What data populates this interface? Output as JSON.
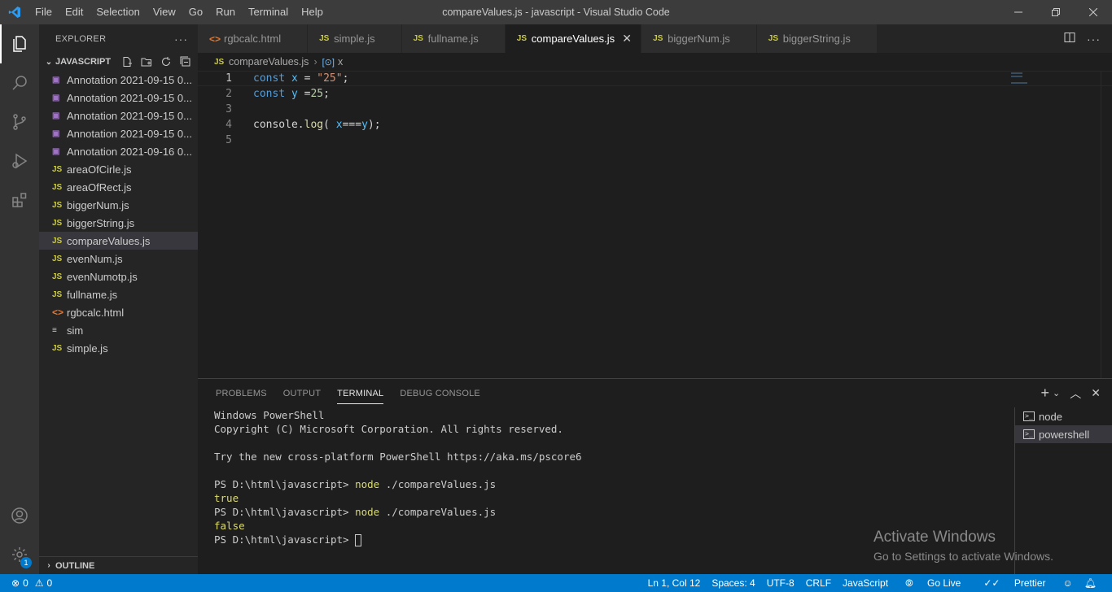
{
  "window": {
    "title": "compareValues.js - javascript - Visual Studio Code",
    "menu": [
      "File",
      "Edit",
      "Selection",
      "View",
      "Go",
      "Run",
      "Terminal",
      "Help"
    ]
  },
  "sidebar": {
    "header": "EXPLORER",
    "folder": "JAVASCRIPT",
    "files": [
      {
        "name": "Annotation 2021-09-15 0...",
        "type": "img"
      },
      {
        "name": "Annotation 2021-09-15 0...",
        "type": "img"
      },
      {
        "name": "Annotation 2021-09-15 0...",
        "type": "img"
      },
      {
        "name": "Annotation 2021-09-15 0...",
        "type": "img"
      },
      {
        "name": "Annotation 2021-09-16 0...",
        "type": "img"
      },
      {
        "name": "areaOfCirle.js",
        "type": "js"
      },
      {
        "name": "areaOfRect.js",
        "type": "js"
      },
      {
        "name": "biggerNum.js",
        "type": "js"
      },
      {
        "name": "biggerString.js",
        "type": "js"
      },
      {
        "name": "compareValues.js",
        "type": "js",
        "selected": true
      },
      {
        "name": "evenNum.js",
        "type": "js"
      },
      {
        "name": "evenNumotp.js",
        "type": "js"
      },
      {
        "name": "fullname.js",
        "type": "js"
      },
      {
        "name": "rgbcalc.html",
        "type": "html"
      },
      {
        "name": "sim",
        "type": "txt"
      },
      {
        "name": "simple.js",
        "type": "js"
      }
    ],
    "outline": "OUTLINE"
  },
  "tabs": [
    {
      "label": "rgbcalc.html",
      "type": "html"
    },
    {
      "label": "simple.js",
      "type": "js"
    },
    {
      "label": "fullname.js",
      "type": "js"
    },
    {
      "label": "compareValues.js",
      "type": "js",
      "active": true
    },
    {
      "label": "biggerNum.js",
      "type": "js"
    },
    {
      "label": "biggerString.js",
      "type": "js"
    }
  ],
  "breadcrumb": {
    "file": "compareValues.js",
    "symbol": "x"
  },
  "editor": {
    "line_numbers": [
      "1",
      "2",
      "3",
      "4",
      "5"
    ],
    "lines": [
      [
        {
          "t": "const ",
          "c": "kw"
        },
        {
          "t": "x",
          "c": "var"
        },
        {
          "t": " = ",
          "c": "plain"
        },
        {
          "t": "\"25\"",
          "c": "str"
        },
        {
          "t": ";",
          "c": "plain"
        }
      ],
      [
        {
          "t": "const ",
          "c": "kw"
        },
        {
          "t": "y",
          "c": "var"
        },
        {
          "t": " =",
          "c": "plain"
        },
        {
          "t": "25",
          "c": "num"
        },
        {
          "t": ";",
          "c": "plain"
        }
      ],
      [],
      [
        {
          "t": "console",
          "c": "plain"
        },
        {
          "t": ".",
          "c": "plain"
        },
        {
          "t": "log",
          "c": "fn"
        },
        {
          "t": "( ",
          "c": "plain"
        },
        {
          "t": "x",
          "c": "var"
        },
        {
          "t": "===",
          "c": "plain"
        },
        {
          "t": "y",
          "c": "var"
        },
        {
          "t": ");",
          "c": "plain"
        }
      ],
      []
    ]
  },
  "panel": {
    "tabs": [
      "PROBLEMS",
      "OUTPUT",
      "TERMINAL",
      "DEBUG CONSOLE"
    ],
    "active_tab": "TERMINAL",
    "terminal_lines": [
      {
        "text": "Windows PowerShell"
      },
      {
        "text": "Copyright (C) Microsoft Corporation. All rights reserved."
      },
      {
        "text": ""
      },
      {
        "text": "Try the new cross-platform PowerShell https://aka.ms/pscore6"
      },
      {
        "text": ""
      },
      {
        "prompt": "PS D:\\html\\javascript> ",
        "cmd": "node",
        "args": " ./compareValues.js"
      },
      {
        "text": "true",
        "out": true
      },
      {
        "prompt": "PS D:\\html\\javascript> ",
        "cmd": "node",
        "args": " ./compareValues.js"
      },
      {
        "text": "false",
        "out": true
      },
      {
        "prompt": "PS D:\\html\\javascript> ",
        "cursor": true
      }
    ],
    "terminals": [
      {
        "label": "node"
      },
      {
        "label": "powershell",
        "active": true
      }
    ]
  },
  "watermark": {
    "line1": "Activate Windows",
    "line2": "Go to Settings to activate Windows."
  },
  "statusbar": {
    "errors": "0",
    "warnings": "0",
    "position": "Ln 1, Col 12",
    "spaces": "Spaces: 4",
    "encoding": "UTF-8",
    "eol": "CRLF",
    "language": "JavaScript",
    "golive": "Go Live",
    "prettier": "Prettier"
  },
  "activity": {
    "settings_badge": "1"
  },
  "colors": {
    "accent": "#007acc",
    "js": "#cbcb41",
    "html": "#e37933"
  }
}
